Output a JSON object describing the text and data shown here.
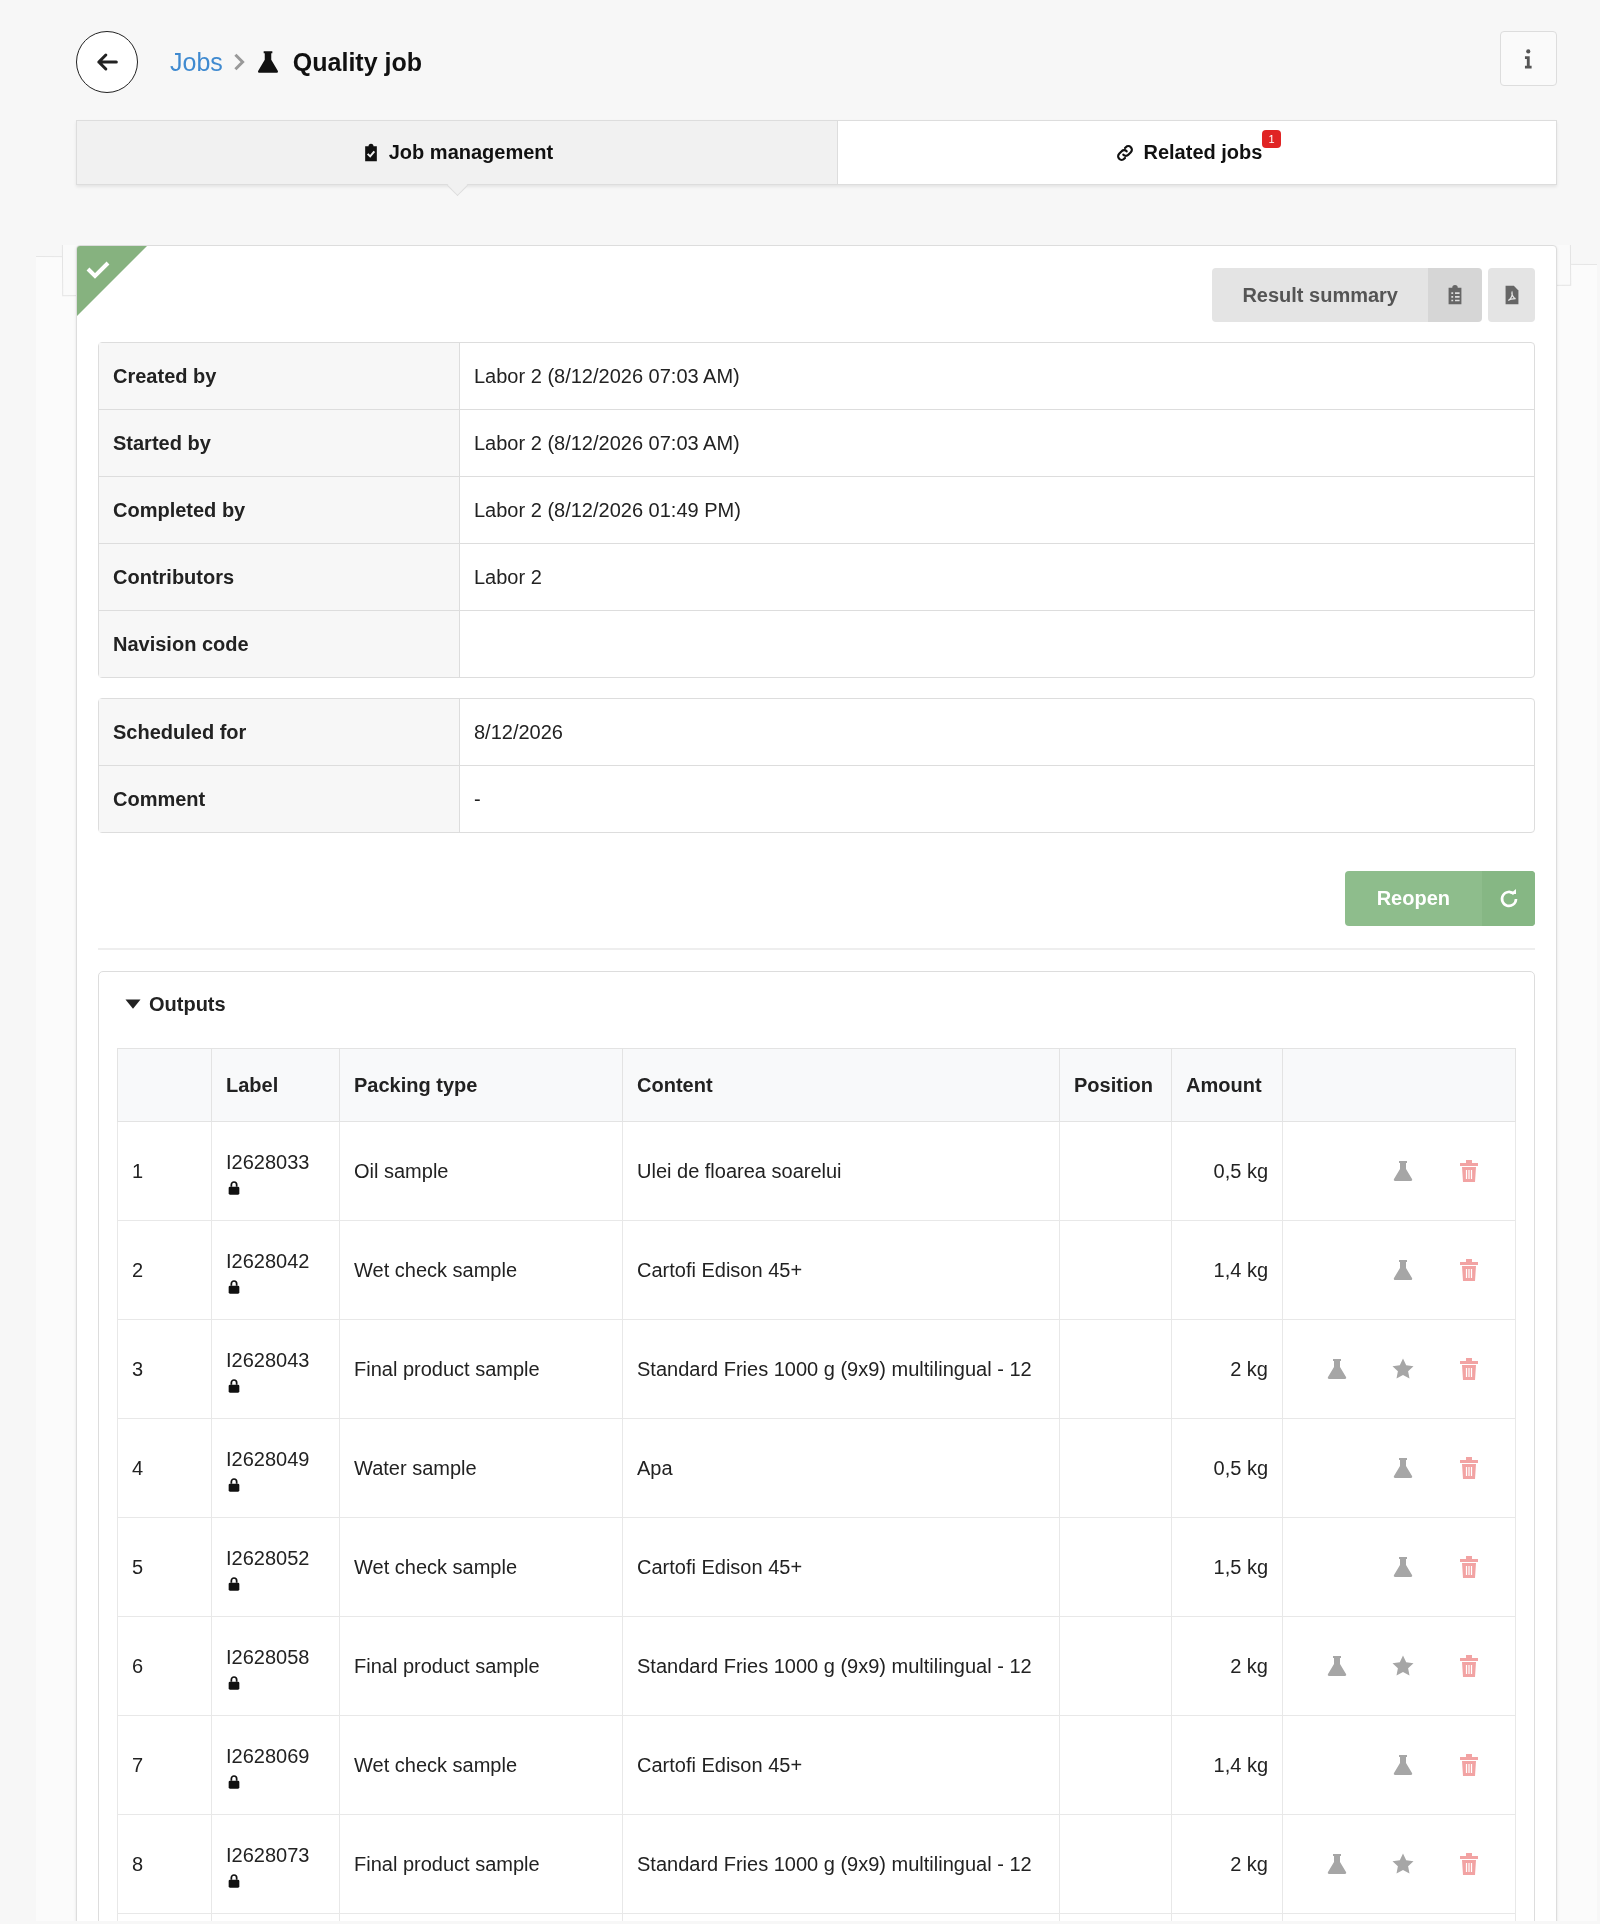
{
  "breadcrumb": [
    {
      "label": "Jobs",
      "kind": "link"
    },
    {
      "label": "Quality job",
      "kind": "current"
    }
  ],
  "tabs": [
    {
      "label": "Job management",
      "kind": "management",
      "selected": true
    },
    {
      "label": "Related jobs",
      "kind": "related",
      "selected": false,
      "badge": "1"
    }
  ],
  "job": {
    "completed": true,
    "summary_button": "Result summary",
    "details": [
      {
        "label": "Created by",
        "value": "Labor 2 (8/12/2026 07:03 AM)"
      },
      {
        "label": "Started by",
        "value": "Labor 2 (8/12/2026 07:03 AM)"
      },
      {
        "label": "Completed by",
        "value": "Labor 2 (8/12/2026 01:49 PM)"
      },
      {
        "label": "Contributors",
        "value": "Labor 2"
      },
      {
        "label": "Navision code"
      }
    ],
    "schedule": [
      {
        "label": "Scheduled for",
        "value": "8/12/2026"
      },
      {
        "label": "Comment",
        "value": "-"
      }
    ],
    "reopen_button": "Reopen"
  },
  "outputs": {
    "title": "Outputs",
    "expanded": true,
    "columns": [
      "Label",
      "Packing type",
      "Content",
      "Position",
      "Amount"
    ],
    "rows": [
      {
        "number": "1",
        "label": "I2628033",
        "locked": true,
        "packing_type": "Oil sample",
        "content": "Ulei de floarea soarelui",
        "amount": "0,5 kg",
        "actions": [
          {
            "kind": "test"
          },
          {
            "kind": "delete"
          }
        ]
      },
      {
        "number": "2",
        "label": "I2628042",
        "locked": true,
        "packing_type": "Wet check sample",
        "content": "Cartofi Edison 45+",
        "amount": "1,4 kg",
        "actions": [
          {
            "kind": "test"
          },
          {
            "kind": "delete"
          }
        ]
      },
      {
        "number": "3",
        "label": "I2628043",
        "locked": true,
        "packing_type": "Final product sample",
        "content": "Standard Fries 1000 g (9x9) multilingual - 12",
        "amount": "2 kg",
        "actions": [
          {
            "kind": "test"
          },
          {
            "kind": "favorite"
          },
          {
            "kind": "delete"
          }
        ]
      },
      {
        "number": "4",
        "label": "I2628049",
        "locked": true,
        "packing_type": "Water sample",
        "content": "Apa",
        "amount": "0,5 kg",
        "actions": [
          {
            "kind": "test"
          },
          {
            "kind": "delete"
          }
        ]
      },
      {
        "number": "5",
        "label": "I2628052",
        "locked": true,
        "packing_type": "Wet check sample",
        "content": "Cartofi Edison 45+",
        "amount": "1,5 kg",
        "actions": [
          {
            "kind": "test"
          },
          {
            "kind": "delete"
          }
        ]
      },
      {
        "number": "6",
        "label": "I2628058",
        "locked": true,
        "packing_type": "Final product sample",
        "content": "Standard Fries 1000 g (9x9) multilingual - 12",
        "amount": "2 kg",
        "actions": [
          {
            "kind": "test"
          },
          {
            "kind": "favorite"
          },
          {
            "kind": "delete"
          }
        ]
      },
      {
        "number": "7",
        "label": "I2628069",
        "locked": true,
        "packing_type": "Wet check sample",
        "content": "Cartofi Edison 45+",
        "amount": "1,4 kg",
        "actions": [
          {
            "kind": "test"
          },
          {
            "kind": "delete"
          }
        ]
      },
      {
        "number": "8",
        "label": "I2628073",
        "locked": true,
        "packing_type": "Final product sample",
        "content": "Standard Fries 1000 g (9x9) multilingual - 12",
        "amount": "2 kg",
        "actions": [
          {
            "kind": "test"
          },
          {
            "kind": "favorite"
          },
          {
            "kind": "delete"
          }
        ]
      }
    ]
  }
}
